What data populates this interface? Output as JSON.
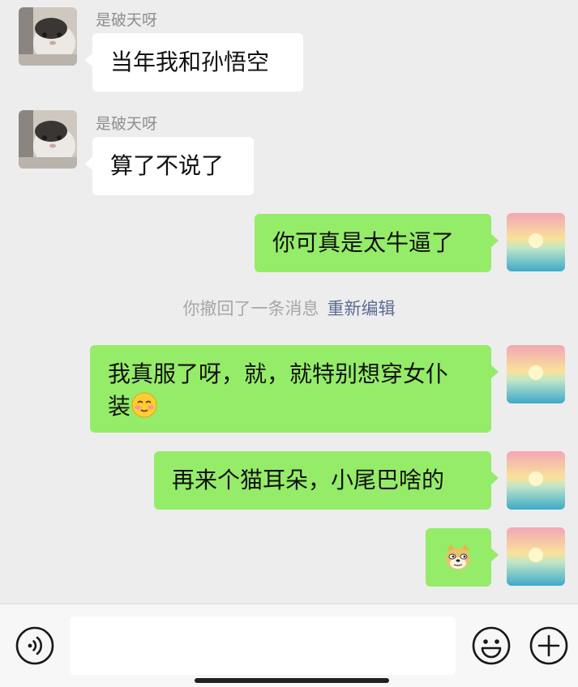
{
  "messages": [
    {
      "side": "in",
      "sender": "是破天呀",
      "text": "当年我和孙悟空"
    },
    {
      "side": "in",
      "sender": "是破天呀",
      "text": "算了不说了"
    },
    {
      "side": "out",
      "text": "你可真是太牛逼了"
    },
    {
      "side": "out",
      "text_line1": "我真服了呀，就，就特别想穿女仆",
      "text_line2": "装",
      "emoji": "smiling-blush-emoji"
    },
    {
      "side": "out",
      "text": "再来个猫耳朵，小尾巴啥的"
    },
    {
      "side": "out",
      "sticker": "doge-emoji"
    }
  ],
  "recall_notice": {
    "text": "你撤回了一条消息",
    "action": "重新编辑"
  },
  "input_bar": {
    "placeholder": "",
    "voice_icon": "voice-icon",
    "emoji_icon": "emoji-icon",
    "plus_icon": "plus-icon"
  },
  "colors": {
    "background": "#ededed",
    "outgoing_bubble": "#95ec69",
    "incoming_bubble": "#ffffff",
    "recall_edit_link": "#5b6b93"
  }
}
